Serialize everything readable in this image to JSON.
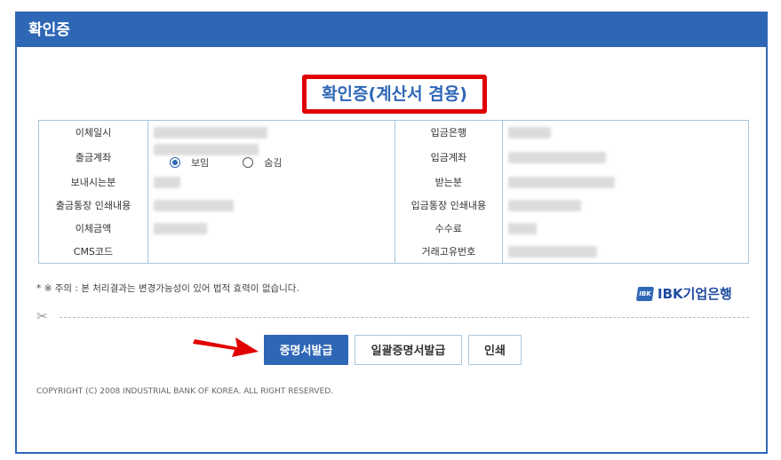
{
  "header": {
    "title": "확인증"
  },
  "document": {
    "title": "확인증(계산서 겸용)"
  },
  "info_left": [
    {
      "label": "이체일시"
    },
    {
      "label": "출금계좌",
      "radio": [
        {
          "label": "보임",
          "checked": true
        },
        {
          "label": "숨김",
          "checked": false
        }
      ]
    },
    {
      "label": "보내시는분"
    },
    {
      "label": "출금통장 인쇄내용"
    },
    {
      "label": "이체금액"
    },
    {
      "label": "CMS코드"
    }
  ],
  "info_right": [
    {
      "label": "입금은행"
    },
    {
      "label": "입금계좌"
    },
    {
      "label": "받는분"
    },
    {
      "label": "입금통장 인쇄내용"
    },
    {
      "label": "수수료"
    },
    {
      "label": "거래고유번호"
    }
  ],
  "notice": "* ※ 주의 : 본 처리결과는 변경가능성이 있어 법적 효력이 없습니다.",
  "logo": {
    "mark": "IBK",
    "text": "IBK기업은행"
  },
  "buttons": {
    "issue": "증명서발급",
    "bulk_issue": "일괄증명서발급",
    "print": "인쇄"
  },
  "copyright": "COPYRIGHT (C) 2008 INDUSTRIAL BANK OF KOREA. ALL RIGHT RESERVED.",
  "colors": {
    "brand": "#2f67b7",
    "highlight": "#e10000",
    "table_border": "#a8c6db"
  },
  "icons": {
    "scissors": "scissors-icon",
    "arrow": "red-arrow-icon"
  }
}
